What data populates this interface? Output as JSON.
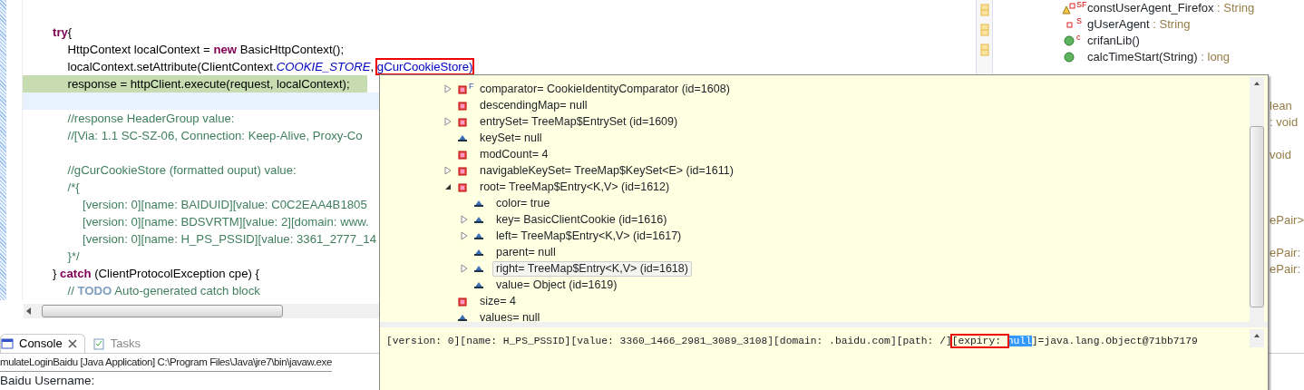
{
  "editor": {
    "lines": [
      {
        "kind": "code",
        "tokens": [
          {
            "kind": "keyword",
            "text": "try"
          },
          {
            "kind": "plain",
            "text": "{"
          }
        ],
        "children": [
          {
            "kind": "code",
            "tokens": [
              {
                "kind": "plain",
                "text": "HttpContext localContext = "
              },
              {
                "kind": "keyword",
                "text": "new"
              },
              {
                "kind": "plain",
                "text": " BasicHttpContext();"
              }
            ]
          },
          {
            "kind": "code",
            "tokens": [
              {
                "kind": "plain",
                "text": "localContext.setAttribute(ClientContext."
              },
              {
                "kind": "constant",
                "text": "COOKIE_STORE"
              },
              {
                "kind": "plain",
                "text": ", "
              },
              {
                "kind": "boxed",
                "text": "gCurCookieStore)"
              }
            ]
          },
          {
            "kind": "debug",
            "tokens": [
              {
                "kind": "plain",
                "text": "response = httpClient.execute(request, localContext);"
              }
            ]
          },
          {
            "kind": "current"
          },
          {
            "kind": "code",
            "tokens": [
              {
                "kind": "comment",
                "text": "//response HeaderGroup value:"
              }
            ]
          },
          {
            "kind": "code",
            "tokens": [
              {
                "kind": "comment",
                "text": "//[Via: 1.1 SC-SZ-06, Connection: Keep-Alive, Proxy-Co"
              }
            ]
          },
          {
            "kind": "blank"
          },
          {
            "kind": "code",
            "tokens": [
              {
                "kind": "comment",
                "text": "//gCurCookieStore (formatted ouput) value:"
              }
            ]
          },
          {
            "kind": "code",
            "tokens": [
              {
                "kind": "comment",
                "text": "/*{"
              }
            ],
            "children": [
              {
                "kind": "code",
                "tokens": [
                  {
                    "kind": "comment",
                    "text": "[version: 0][name: BAIDUID][value: C0C2EAA4B1805"
                  }
                ]
              },
              {
                "kind": "code",
                "tokens": [
                  {
                    "kind": "comment",
                    "text": "[version: 0][name: BDSVRTM][value: 2][domain: www."
                  }
                ]
              },
              {
                "kind": "code",
                "tokens": [
                  {
                    "kind": "comment",
                    "text": "[version: 0][name: H_PS_PSSID][value: 3361_2777_14"
                  }
                ]
              }
            ]
          },
          {
            "kind": "code",
            "tokens": [
              {
                "kind": "comment",
                "text": "}*/"
              }
            ]
          }
        ]
      },
      {
        "kind": "code",
        "tokens": [
          {
            "kind": "plain",
            "text": "} "
          },
          {
            "kind": "keyword",
            "text": "catch"
          },
          {
            "kind": "plain",
            "text": " (ClientProtocolException cpe) {"
          }
        ],
        "children": [
          {
            "kind": "code",
            "tokens": [
              {
                "kind": "comment",
                "text": "// "
              },
              {
                "kind": "todo",
                "text": "TODO"
              },
              {
                "kind": "comment",
                "text": " Auto-generated catch block"
              }
            ]
          }
        ]
      }
    ]
  },
  "outline": {
    "items": [
      {
        "kind": "field",
        "warning": true,
        "badge": "SF",
        "name": "constUserAgent_Firefox",
        "type": " : String"
      },
      {
        "kind": "field",
        "warning": false,
        "badge": "S",
        "name": "gUserAgent",
        "type": " : String"
      },
      {
        "kind": "method",
        "badge": "c",
        "name": "crifanLib()"
      },
      {
        "kind": "method",
        "name": "calcTimeStart(String)",
        "type": " : long"
      }
    ],
    "fragments": [
      "lean",
      ": void",
      "void",
      "ePair>",
      "ePair:",
      "ePair:"
    ]
  },
  "console": {
    "tabs": [
      {
        "label": "Console",
        "selected": true,
        "closable": true
      },
      {
        "label": "Tasks",
        "selected": false,
        "closable": false
      }
    ],
    "process": "mulateLoginBaidu [Java Application] C:\\Program Files\\Java\\jre7\\bin\\javaw.exe",
    "output": "Baidu Username:"
  },
  "popup": {
    "tree": [
      {
        "name": "comparator= CookieIdentityComparator  (id=1608)",
        "kind": "private",
        "badge": "F",
        "expanded": false,
        "selected": false
      },
      {
        "name": "descendingMap= null",
        "kind": "private",
        "selected": false
      },
      {
        "name": "entrySet= TreeMap$EntrySet  (id=1609)",
        "kind": "private",
        "expanded": false,
        "selected": false
      },
      {
        "name": "keySet= null",
        "kind": "package",
        "selected": false
      },
      {
        "name": "modCount= 4",
        "kind": "private",
        "selected": false
      },
      {
        "name": "navigableKeySet= TreeMap$KeySet<E>  (id=1611)",
        "kind": "private",
        "expanded": false,
        "selected": false
      },
      {
        "name": "root= TreeMap$Entry<K,V>  (id=1612)",
        "kind": "private",
        "expanded": true,
        "selected": false,
        "children": [
          {
            "name": "color= true",
            "kind": "package",
            "selected": false
          },
          {
            "name": "key= BasicClientCookie  (id=1616)",
            "kind": "package",
            "expanded": false,
            "selected": false
          },
          {
            "name": "left= TreeMap$Entry<K,V>  (id=1617)",
            "kind": "package",
            "expanded": false,
            "selected": false
          },
          {
            "name": "parent= null",
            "kind": "package",
            "selected": false
          },
          {
            "name": "right= TreeMap$Entry<K,V>  (id=1618)",
            "kind": "package",
            "expanded": false,
            "selected": true
          },
          {
            "name": "value= Object  (id=1619)",
            "kind": "package",
            "selected": false
          }
        ]
      },
      {
        "name": "size= 4",
        "kind": "private",
        "selected": false
      },
      {
        "name": "values= null",
        "kind": "package",
        "selected": false
      }
    ],
    "detail": [
      {
        "kind": "plain",
        "text": "[version: 0][name: H_PS_PSSID][value: 3360_1466_2981_3089_3108][domain: .baidu.com][path: /]"
      },
      {
        "kind": "boxed",
        "text": "[expiry: "
      },
      {
        "kind": "selected",
        "text": "null"
      },
      {
        "kind": "plain",
        "text": "]=java.lang.Object@71bb7179"
      }
    ]
  }
}
